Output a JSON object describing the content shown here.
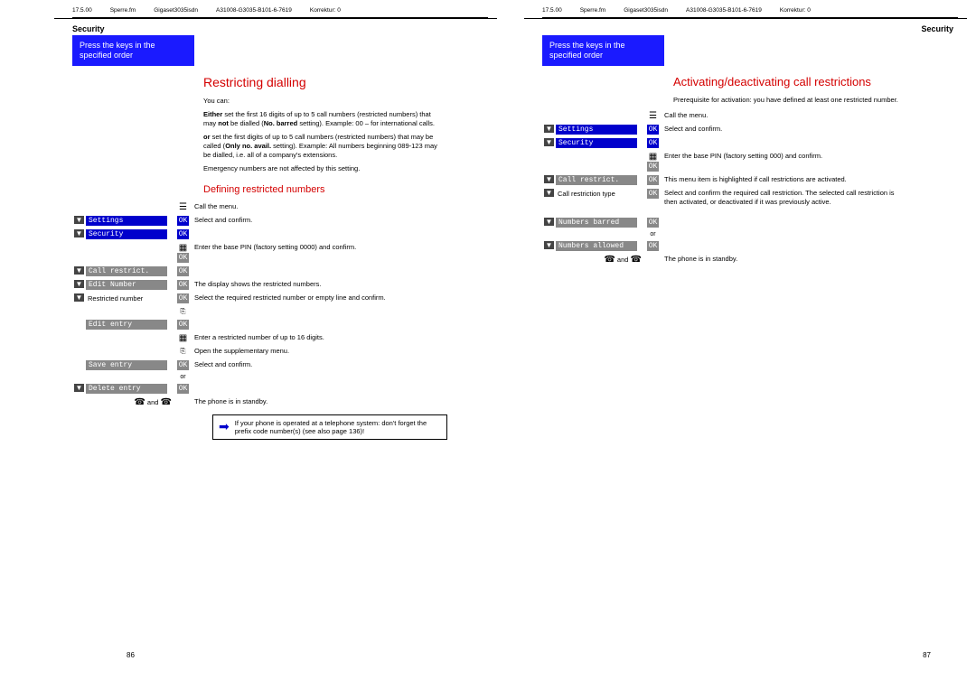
{
  "meta": {
    "date": "17.5.00",
    "file": "Sperre.fm",
    "product": "Gigaset3035isdn",
    "doc": "A31008-G3035-B101-6-7619",
    "korr": "Korrektur: 0"
  },
  "banner": "Press the keys in the specified order",
  "section": "Security",
  "left": {
    "title": "Restricting dialling",
    "intro": "You can:",
    "para1a": "Either",
    "para1b": " set the first 16 digits of up to 5 call numbers (restricted numbers) that may ",
    "para1c": "not",
    "para1d": " be dialled (",
    "para1e": "No. barred",
    "para1f": " setting). Example: 00 – for international calls.",
    "para2a": "or",
    "para2b": " set the first digits of up to 5 call numbers (restricted numbers) that may be called (",
    "para2c": "Only no. avail.",
    "para2d": " setting). Example: All numbers beginning 089-123 may be dialled, i.e. all of a company's extensions.",
    "para3": "Emergency numbers are not affected by this setting.",
    "sub": "Defining restricted numbers",
    "steps": {
      "call_menu": "Call the menu.",
      "settings": "Settings",
      "select_confirm": "Select and confirm.",
      "security": "Security",
      "enter_pin": "Enter the base PIN (factory setting 0000) and confirm.",
      "call_restrict": "Call restrict.",
      "edit_number": "Edit Number",
      "display_shows": "The display shows the restricted numbers.",
      "restricted_number": "Restricted number",
      "select_required": "Select the required restricted number or empty line and confirm.",
      "edit_entry": "Edit entry",
      "enter_restricted": "Enter a restricted number of up to 16 digits.",
      "open_supp": "Open the supplementary menu.",
      "save_entry": "Save entry",
      "or": "or",
      "delete_entry": "Delete entry",
      "and": "and",
      "standby": "The phone is in standby.",
      "ok": "OK"
    },
    "note": "If your phone is operated at a telephone system: don't forget the prefix code number(s) (see also page 136)!",
    "pgnum": "86"
  },
  "right": {
    "title": "Activating/deactivating call restrictions",
    "prereq": "Prerequisite for activation: you have defined at least one restricted number.",
    "steps": {
      "call_menu": "Call the menu.",
      "settings": "Settings",
      "select_confirm": "Select and confirm.",
      "security": "Security",
      "enter_pin": "Enter the base PIN (factory setting 000) and confirm.",
      "call_restrict": "Call restrict.",
      "highlighted": "This menu item is highlighted if call restrictions are activated.",
      "call_restrict_type": "Call restriction type",
      "select_confirm_req": "Select and confirm the required call restriction. The selected call restriction is then activated, or deactivated if it was previously active.",
      "numbers_barred": "Numbers barred",
      "or": "or",
      "numbers_allowed": "Numbers allowed",
      "and": "and",
      "standby": "The phone is in standby.",
      "ok": "OK"
    },
    "pgnum": "87"
  }
}
